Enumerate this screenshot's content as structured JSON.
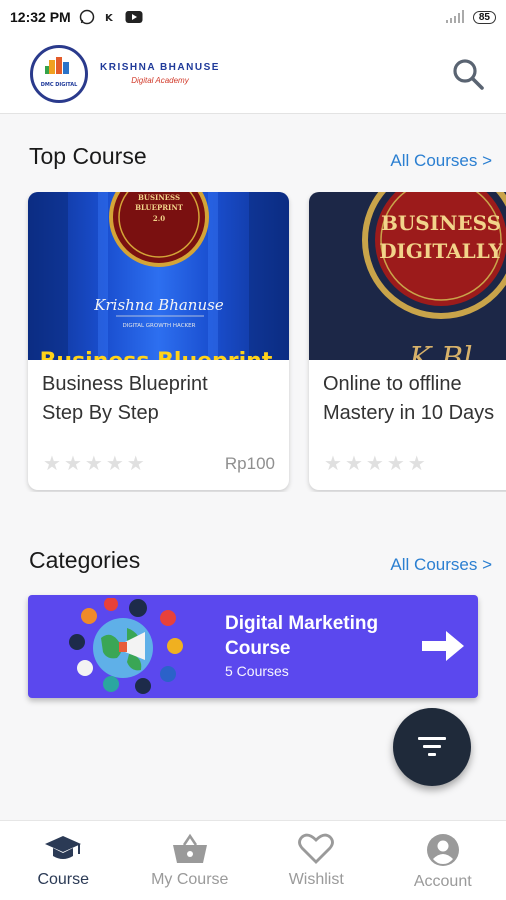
{
  "status_bar": {
    "time": "12:32 PM",
    "battery": "85"
  },
  "header": {
    "brand_name": "KRISHNA BHANUSE",
    "brand_sub": "Digital Academy",
    "logo_text": "DMC DIGITAL"
  },
  "top_course": {
    "title": "Top Course",
    "link": "All Courses >",
    "cards": [
      {
        "title_line1": "Business Blueprint",
        "title_line2": "Step By Step",
        "price": "Rp100",
        "thumb_banner": "Business Blueprint",
        "thumb_seal": "BUSINESS BLUEPRINT 2.0"
      },
      {
        "title_line1": "Online to offline",
        "title_line2": "Mastery in 10 Days",
        "price": "",
        "thumb_line1": "BUSINESS",
        "thumb_line2": "DIGITALLY"
      }
    ]
  },
  "categories": {
    "title": "Categories",
    "link": "All Courses >",
    "items": [
      {
        "name_line1": "Digital Marketing",
        "name_line2": "Course",
        "count": "5 Courses"
      }
    ]
  },
  "bottom_nav": [
    {
      "label": "Course",
      "icon": "graduation-cap-icon",
      "active": true
    },
    {
      "label": "My Course",
      "icon": "basket-icon",
      "active": false
    },
    {
      "label": "Wishlist",
      "icon": "heart-icon",
      "active": false
    },
    {
      "label": "Account",
      "icon": "account-icon",
      "active": false
    }
  ],
  "colors": {
    "accent": "#2b7fd1",
    "banner": "#5b48ee",
    "fab": "#1f2a3a",
    "nav_active": "#2b3a55"
  }
}
